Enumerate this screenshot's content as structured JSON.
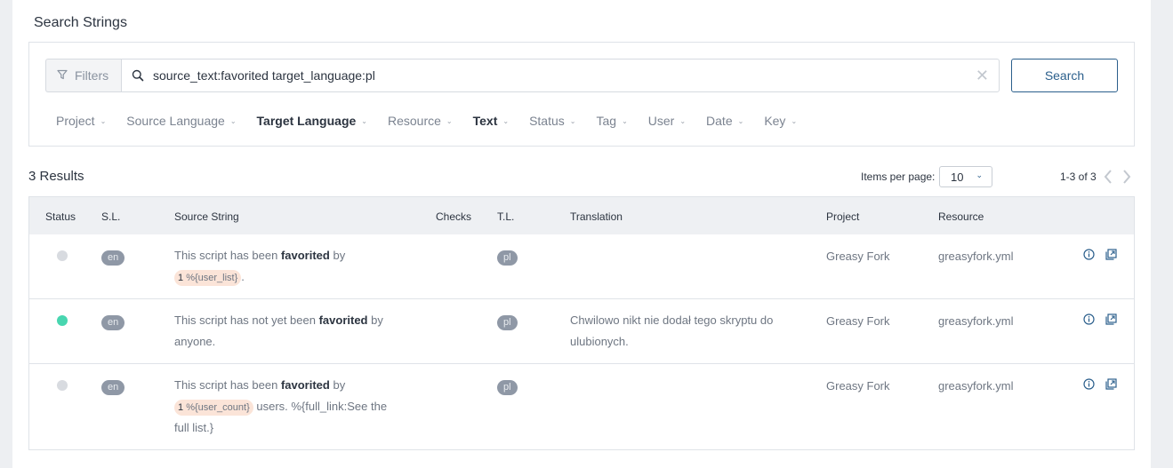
{
  "page_title": "Search Strings",
  "filters_label": "Filters",
  "search": {
    "value": "source_text:favorited target_language:pl",
    "button": "Search"
  },
  "facets": [
    {
      "label": "Project",
      "active": false
    },
    {
      "label": "Source Language",
      "active": false
    },
    {
      "label": "Target Language",
      "active": true
    },
    {
      "label": "Resource",
      "active": false
    },
    {
      "label": "Text",
      "active": true
    },
    {
      "label": "Status",
      "active": false
    },
    {
      "label": "Tag",
      "active": false
    },
    {
      "label": "User",
      "active": false
    },
    {
      "label": "Date",
      "active": false
    },
    {
      "label": "Key",
      "active": false
    }
  ],
  "results": {
    "count_label": "3 Results",
    "items_per_page_label": "Items per page:",
    "items_per_page_value": "10",
    "range_label": "1-3 of 3"
  },
  "table": {
    "headers": {
      "status": "Status",
      "sl": "S.L.",
      "source": "Source String",
      "checks": "Checks",
      "tl": "T.L.",
      "translation": "Translation",
      "project": "Project",
      "resource": "Resource"
    },
    "rows": [
      {
        "status_color": "#d8dbe0",
        "sl": "en",
        "src_a": "This script has been ",
        "src_bold": "favorited",
        "src_b": " by",
        "ph_num": "1",
        "ph_text": "%{user_list}",
        "src_c": ".",
        "tl": "pl",
        "translation_1": "",
        "translation_2": "",
        "project": "Greasy Fork",
        "resource": "greasyfork.yml"
      },
      {
        "status_color": "#48d6b0",
        "sl": "en",
        "src_a": "This script has not yet been ",
        "src_bold": "favorited",
        "src_b": " by",
        "src_line2": "anyone.",
        "tl": "pl",
        "translation_1": "Chwilowo nikt nie dodał tego skryptu do",
        "translation_2": "ulubionych.",
        "project": "Greasy Fork",
        "resource": "greasyfork.yml"
      },
      {
        "status_color": "#d8dbe0",
        "sl": "en",
        "src_a": "This script has been ",
        "src_bold": "favorited",
        "src_b": " by",
        "ph_num": "1",
        "ph_text": "%{user_count}",
        "src_c": " users. %{full_link:See the",
        "src_line3": "full list.}",
        "tl": "pl",
        "translation_1": "",
        "translation_2": "",
        "project": "Greasy Fork",
        "resource": "greasyfork.yml"
      }
    ]
  },
  "colors": {
    "accent": "#2b5f8c",
    "status_untranslated": "#d8dbe0",
    "status_translated": "#48d6b0",
    "placeholder_bg": "#fbe4d8"
  }
}
